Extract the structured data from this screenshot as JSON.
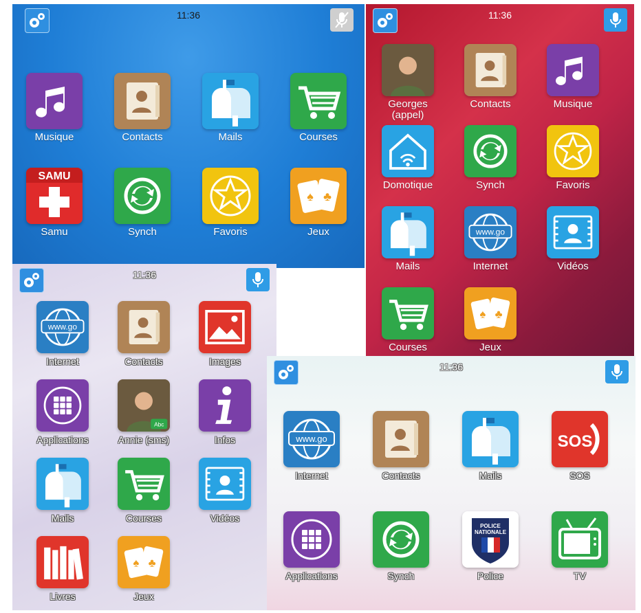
{
  "panels": {
    "blue": {
      "time": "11:36",
      "apps": [
        {
          "label": "Musique",
          "icon": "music-icon"
        },
        {
          "label": "Contacts",
          "icon": "contacts-icon"
        },
        {
          "label": "Mails",
          "icon": "mailbox-icon"
        },
        {
          "label": "Courses",
          "icon": "cart-icon"
        },
        {
          "label": "Samu",
          "icon": "samu-icon",
          "badge": "SAMU"
        },
        {
          "label": "Synch",
          "icon": "sync-icon"
        },
        {
          "label": "Favoris",
          "icon": "star-icon"
        },
        {
          "label": "Jeux",
          "icon": "cards-icon"
        }
      ]
    },
    "red": {
      "time": "11:36",
      "apps": [
        {
          "label": "Georges\n(appel)",
          "icon": "contact-photo-icon"
        },
        {
          "label": "Contacts",
          "icon": "contacts-icon"
        },
        {
          "label": "Musique",
          "icon": "music-icon"
        },
        {
          "label": "Domotique",
          "icon": "smart-home-icon"
        },
        {
          "label": "Synch",
          "icon": "sync-icon"
        },
        {
          "label": "Favoris",
          "icon": "star-icon"
        },
        {
          "label": "Mails",
          "icon": "mailbox-icon"
        },
        {
          "label": "Internet",
          "icon": "globe-icon",
          "badge": "www.go"
        },
        {
          "label": "Vidéos",
          "icon": "video-icon"
        },
        {
          "label": "Courses",
          "icon": "cart-icon"
        },
        {
          "label": "Jeux",
          "icon": "cards-icon"
        }
      ]
    },
    "paper": {
      "time": "11:36",
      "apps": [
        {
          "label": "Internet",
          "icon": "globe-icon",
          "badge": "www.go"
        },
        {
          "label": "Contacts",
          "icon": "contacts-icon"
        },
        {
          "label": "Images",
          "icon": "image-icon"
        },
        {
          "label": "Applications",
          "icon": "apps-grid-icon"
        },
        {
          "label": "Annie (sms)",
          "icon": "contact-photo-icon",
          "badge": "Abc"
        },
        {
          "label": "Infos",
          "icon": "info-icon"
        },
        {
          "label": "Mails",
          "icon": "mailbox-icon"
        },
        {
          "label": "Courses",
          "icon": "cart-icon"
        },
        {
          "label": "Vidéos",
          "icon": "video-icon"
        },
        {
          "label": "Livres",
          "icon": "books-icon"
        },
        {
          "label": "Jeux",
          "icon": "cards-icon"
        }
      ]
    },
    "white": {
      "time": "11:36",
      "apps": [
        {
          "label": "Internet",
          "icon": "globe-icon",
          "badge": "www.go"
        },
        {
          "label": "Contacts",
          "icon": "contacts-icon"
        },
        {
          "label": "Mails",
          "icon": "mailbox-icon"
        },
        {
          "label": "SOS",
          "icon": "sos-icon",
          "badge": "SOS"
        },
        {
          "label": "Applications",
          "icon": "apps-grid-icon"
        },
        {
          "label": "Synch",
          "icon": "sync-icon"
        },
        {
          "label": "Police",
          "icon": "police-icon",
          "badge": "POLICE\nNATIONALE"
        },
        {
          "label": "TV",
          "icon": "tv-icon"
        }
      ]
    }
  },
  "colors": {
    "music": "#7a3fa8",
    "contacts": "#b08456",
    "mail": "#29a3e3",
    "cart": "#2fa84a",
    "samu": "#e02b2b",
    "sync": "#2fa84a",
    "star": "#f1c40f",
    "cards": "#f0a020",
    "home": "#29a3e3",
    "globe": "#2a7fc4",
    "video": "#29a3e3",
    "image": "#e0352b",
    "apps": "#7a3fa8",
    "info": "#7a3fa8",
    "books": "#e0352b",
    "sos": "#e0352b",
    "police": "#1f2f66",
    "tv": "#2fa84a"
  }
}
